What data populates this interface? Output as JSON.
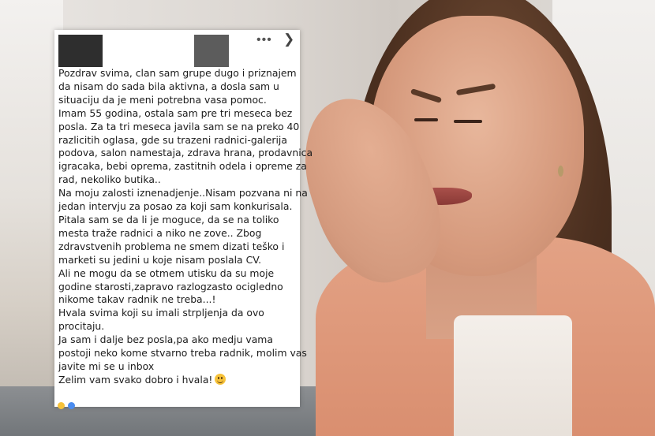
{
  "post": {
    "lines": [
      "Pozdrav svima, clan sam grupe dugo i priznajem",
      "da nisam do sada bila aktivna, a dosla sam u",
      "situaciju da je meni potrebna vasa pomoc.",
      "Imam 55 godina, ostala sam pre tri meseca bez",
      "posla. Za ta tri meseca javila sam se na preko 40",
      "razlicitih oglasa, gde su trazeni radnici-galerija",
      "podova, salon namestaja, zdrava hrana, prodavnica",
      "igracaka, bebi oprema, zastitnih odela i opreme za",
      "rad, nekoliko butika..",
      "Na moju zalosti iznenadjenje..Nisam pozvana ni na",
      "jedan intervju za posao za koji sam konkurisala.",
      "Pitala sam se da li je moguce, da se na toliko",
      "mesta traže radnici a niko ne zove.. Zbog",
      "zdravstvenih problema ne smem dizati teško i",
      "marketi su jedini u koje nisam poslala CV.",
      "Ali ne mogu da se otmem utisku da su moje",
      "godine starosti,zapravo razlogzasto ocigledno",
      "nikome takav radnik ne treba...!",
      "Hvala svima koji su imali strpljenja da ovo",
      "procitaju.",
      "Ja sam i dalje bez posla,pa ako medju vama",
      "postoji neko kome stvarno treba radnik, molim vas",
      "javite mi se u inbox",
      "Zelim vam svako dobro i hvala!"
    ],
    "more_icon": "•••",
    "close_icon": "❯",
    "emoji": "smiling-face",
    "reaction_colors": [
      "#f6c23a",
      "#4a8cf0"
    ]
  }
}
